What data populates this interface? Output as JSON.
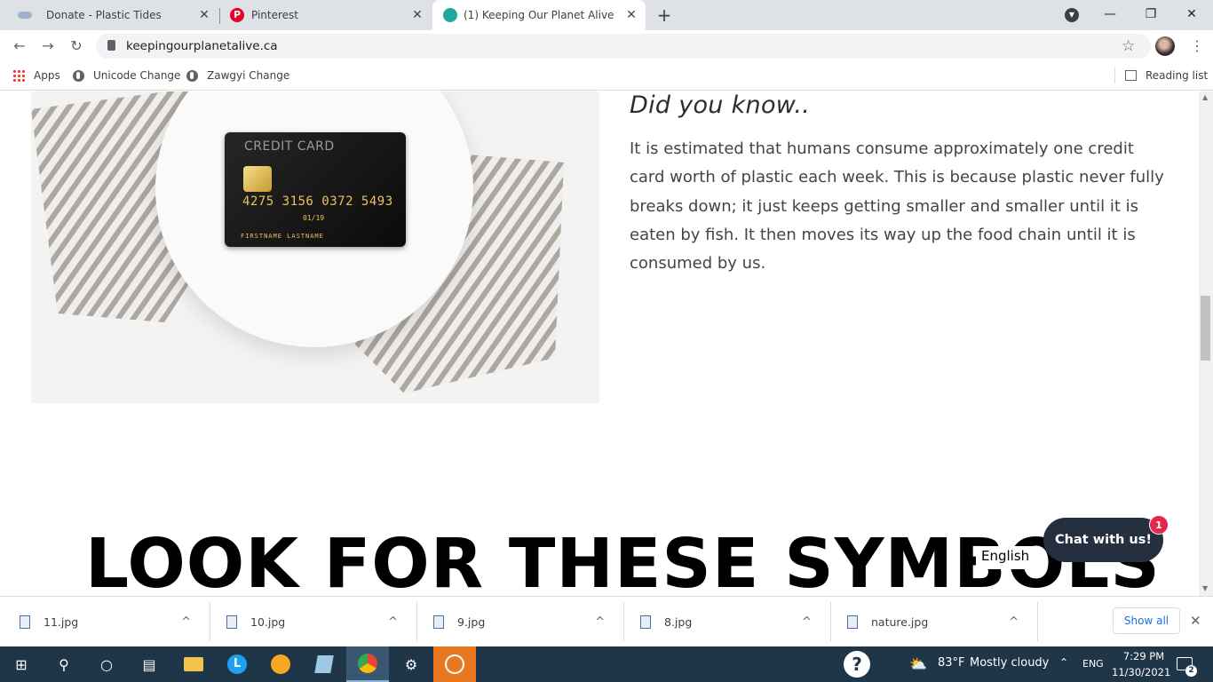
{
  "browser": {
    "tabs": [
      {
        "title": "Donate - Plastic Tides",
        "icon": "wave-favicon"
      },
      {
        "title": "Pinterest",
        "icon": "pinterest-favicon"
      },
      {
        "title": "(1) Keeping Our Planet Alive",
        "icon": "planet-favicon",
        "active": true
      }
    ],
    "new_tab": "+",
    "url": "keepingourplanetalive.ca",
    "bookmarks": [
      {
        "label": "Apps",
        "icon": "apps-grid-icon"
      },
      {
        "label": "Unicode Change",
        "icon": "globe-icon"
      },
      {
        "label": "Zawgyi Change",
        "icon": "globe-icon"
      }
    ],
    "reading_list": "Reading list"
  },
  "page": {
    "image": {
      "card_title": "CREDIT CARD",
      "card_number": "4275 3156 0372 5493",
      "card_expiry": "01/19",
      "card_name": "FIRSTNAME LASTNAME"
    },
    "heading": "Did you know..",
    "body": "It is estimated that humans consume approximately one credit card worth of plastic each week. This is because plastic never fully breaks down; it just keeps getting smaller and smaller until it is eaten by fish. It then moves its way up the food chain until it is consumed by us.",
    "headline": "LOOK FOR THESE SYMBOLS",
    "language": "English",
    "chat": {
      "label": "Chat with us!",
      "badge": "1"
    }
  },
  "downloads": {
    "files": [
      "11.jpg",
      "10.jpg",
      "9.jpg",
      "8.jpg",
      "nature.jpg"
    ],
    "show_all": "Show all"
  },
  "taskbar": {
    "weather_temp": "83°F",
    "weather_desc": "Mostly cloudy",
    "lang": "ENG",
    "time": "7:29 PM",
    "date": "11/30/2021",
    "notifications": "2"
  },
  "colors": {
    "chat_bg": "#243040",
    "badge": "#e5284a",
    "taskbar": "#1f3548",
    "link": "#1a73e8"
  }
}
